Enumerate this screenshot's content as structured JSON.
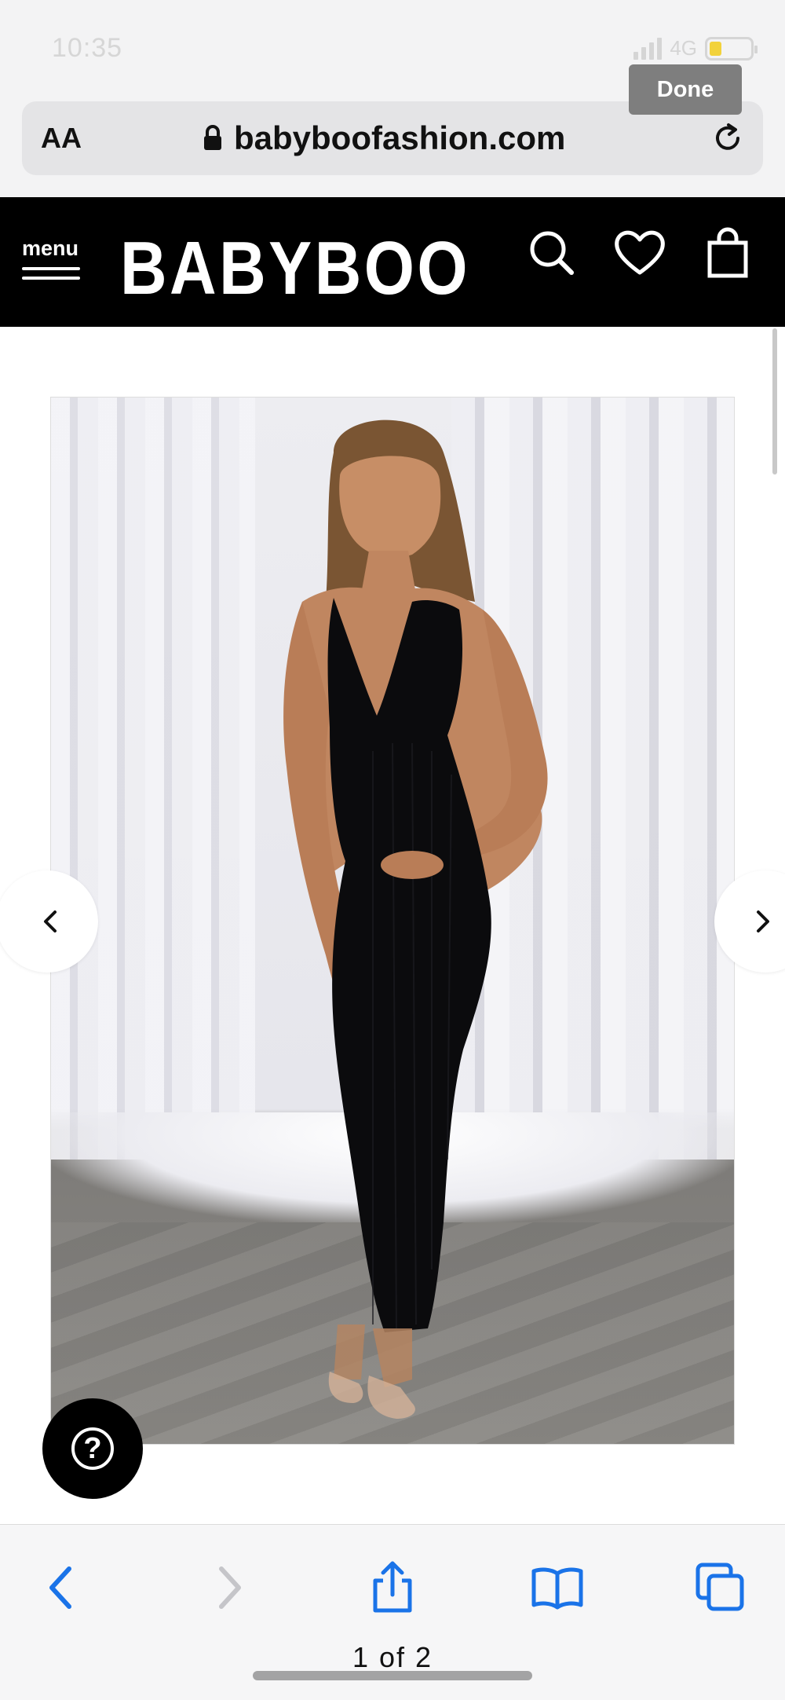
{
  "status_bar": {
    "time": "10:35",
    "network": "4G",
    "battery_level": 0.3
  },
  "keyboard": {
    "done_label": "Done"
  },
  "url_bar": {
    "text_size_label": "AA",
    "url": "babyboofashion.com"
  },
  "site_header": {
    "menu_label": "menu",
    "logo": "BABYBOO"
  },
  "colors": {
    "header_bg": "#000000",
    "ios_blue": "#1a73e8",
    "toolbar_bg": "#f6f6f7"
  },
  "toolbar": {
    "page_indicator": "1 of 2"
  },
  "icons": {
    "search": "search-icon",
    "wishlist": "heart-icon",
    "cart": "shopping-bag-icon",
    "help": "question-mark-icon",
    "reload": "reload-icon",
    "lock": "lock-icon"
  }
}
